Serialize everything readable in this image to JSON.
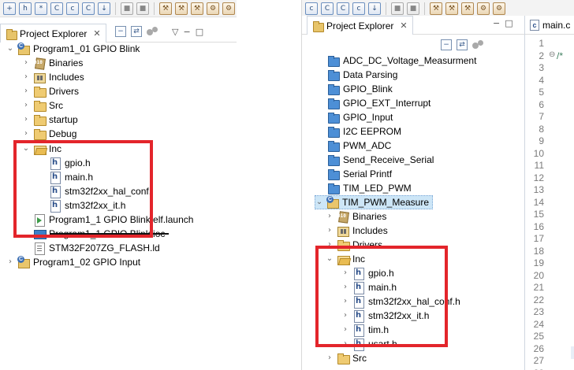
{
  "left": {
    "view_title": "Project Explorer",
    "tree": [
      {
        "label": "Program1_01 GPIO Blink",
        "icon": "project-icon",
        "chevron": "down"
      },
      {
        "label": "Binaries",
        "icon": "binaries-icon",
        "chevron": "right"
      },
      {
        "label": "Includes",
        "icon": "includes-icon",
        "chevron": "right"
      },
      {
        "label": "Drivers",
        "icon": "folder-icon",
        "chevron": "right"
      },
      {
        "label": "Src",
        "icon": "folder-icon",
        "chevron": "right"
      },
      {
        "label": "startup",
        "icon": "folder-icon",
        "chevron": "right"
      },
      {
        "label": "Debug",
        "icon": "folder-icon",
        "chevron": "right"
      },
      {
        "label": "Inc",
        "icon": "folder-open-icon",
        "chevron": "down"
      },
      {
        "label": "gpio.h",
        "icon": "header-file-icon"
      },
      {
        "label": "main.h",
        "icon": "header-file-icon"
      },
      {
        "label": "stm32f2xx_hal_conf.",
        "icon": "header-file-icon"
      },
      {
        "label": "stm32f2xx_it.h",
        "icon": "header-file-icon"
      },
      {
        "label": "Program1_1 GPIO Blink.elf.launch",
        "icon": "launch-file-icon"
      },
      {
        "label": "Program1_1 GPIO Blink.ioc",
        "icon": "ioc-file-icon"
      },
      {
        "label": "STM32F207ZG_FLASH.ld",
        "icon": "linker-file-icon"
      },
      {
        "label": "Program1_02 GPIO Input",
        "icon": "project-icon",
        "chevron": "right"
      }
    ]
  },
  "right": {
    "view_title": "Project Explorer",
    "editor_tab": "main.c",
    "tree": [
      {
        "label": "ADC_DC_Voltage_Measurment",
        "icon": "closed-project-icon"
      },
      {
        "label": "Data Parsing",
        "icon": "closed-project-icon"
      },
      {
        "label": "GPIO_Blink",
        "icon": "closed-project-icon"
      },
      {
        "label": "GPIO_EXT_Interrupt",
        "icon": "closed-project-icon"
      },
      {
        "label": "GPIO_Input",
        "icon": "closed-project-icon"
      },
      {
        "label": "I2C EEPROM",
        "icon": "closed-project-icon"
      },
      {
        "label": "PWM_ADC",
        "icon": "closed-project-icon"
      },
      {
        "label": "Send_Receive_Serial",
        "icon": "closed-project-icon"
      },
      {
        "label": "Serial Printf",
        "icon": "closed-project-icon"
      },
      {
        "label": "TIM_LED_PWM",
        "icon": "closed-project-icon"
      },
      {
        "label": "TIM_PWM_Measure",
        "icon": "project-icon",
        "chevron": "down"
      },
      {
        "label": "Binaries",
        "icon": "binaries-icon",
        "chevron": "right"
      },
      {
        "label": "Includes",
        "icon": "includes-icon",
        "chevron": "right"
      },
      {
        "label": "Drivers",
        "icon": "folder-icon",
        "chevron": "right"
      },
      {
        "label": "Inc",
        "icon": "folder-open-icon",
        "chevron": "down"
      },
      {
        "label": "gpio.h",
        "icon": "header-file-icon",
        "chevron": "right"
      },
      {
        "label": "main.h",
        "icon": "header-file-icon",
        "chevron": "right"
      },
      {
        "label": "stm32f2xx_hal_conf.h",
        "icon": "header-file-icon",
        "chevron": "right"
      },
      {
        "label": "stm32f2xx_it.h",
        "icon": "header-file-icon",
        "chevron": "right"
      },
      {
        "label": "tim.h",
        "icon": "header-file-icon",
        "chevron": "right"
      },
      {
        "label": "usart.h",
        "icon": "header-file-icon",
        "chevron": "right"
      },
      {
        "label": "Src",
        "icon": "folder-icon",
        "chevron": "right"
      }
    ],
    "line_numbers": [
      "1",
      "2",
      "3",
      "4",
      "5",
      "6",
      "7",
      "8",
      "9",
      "10",
      "11",
      "12",
      "13",
      "14",
      "15",
      "16",
      "17",
      "18",
      "19",
      "20",
      "21",
      "22",
      "23",
      "24",
      "25",
      "26",
      "27",
      "28"
    ],
    "code_line_2": "/*"
  },
  "colors": {
    "highlight": "#e3252b",
    "selection": "#cde6f7"
  }
}
